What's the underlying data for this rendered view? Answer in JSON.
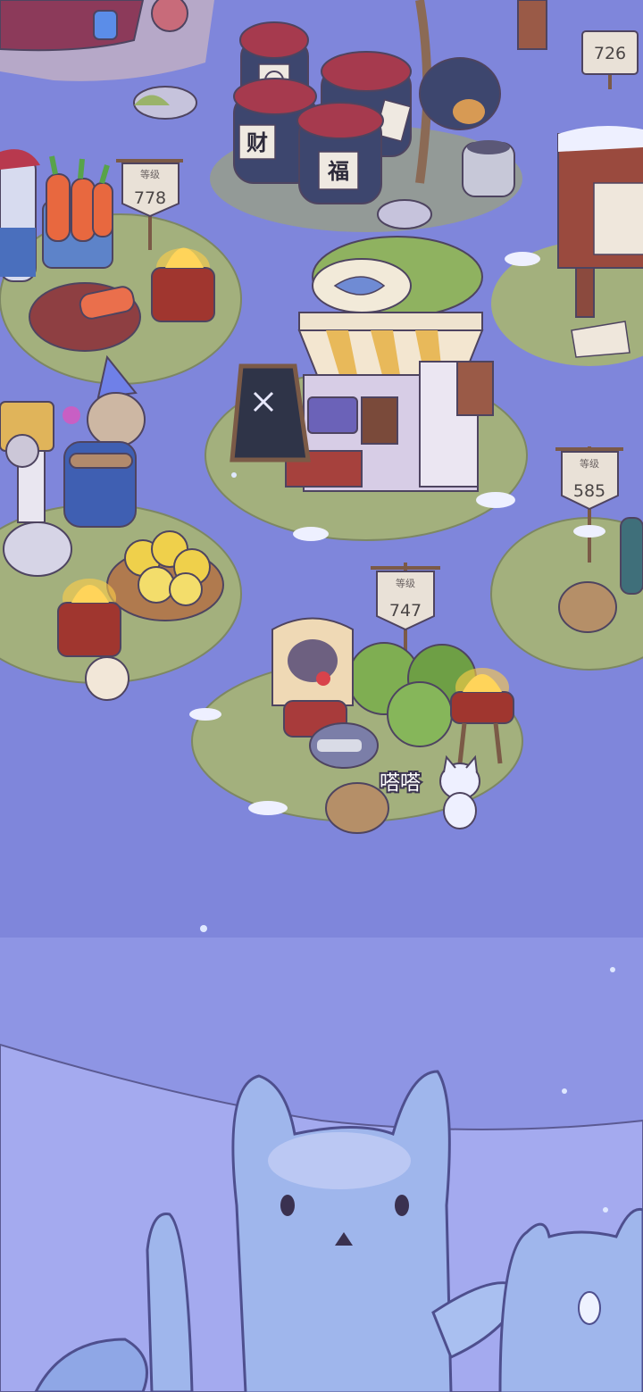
{
  "scene": {
    "colors": {
      "ground": "#7f86db",
      "grass": "#a3b07d",
      "dirt": "#c8b48a",
      "snow": "#f0f2ff",
      "outline": "#4e4460",
      "fire": "#ffcf48"
    }
  },
  "stalls": [
    {
      "id": "carrot",
      "sign_sub": "等级",
      "level": "778"
    },
    {
      "id": "top-right",
      "sign_sub": "",
      "level": "726"
    },
    {
      "id": "right",
      "sign_sub": "等级",
      "level": "585"
    },
    {
      "id": "cabbage",
      "sign_sub": "等级",
      "level": "747"
    }
  ],
  "jars": [
    {
      "label": "财"
    },
    {
      "label": "福"
    }
  ],
  "speech": {
    "text": "嗒嗒"
  },
  "icons": {
    "shop": "food-shop-building",
    "menu_board": "menu-chalkboard-icon",
    "notice_board": "notice-board-icon"
  }
}
